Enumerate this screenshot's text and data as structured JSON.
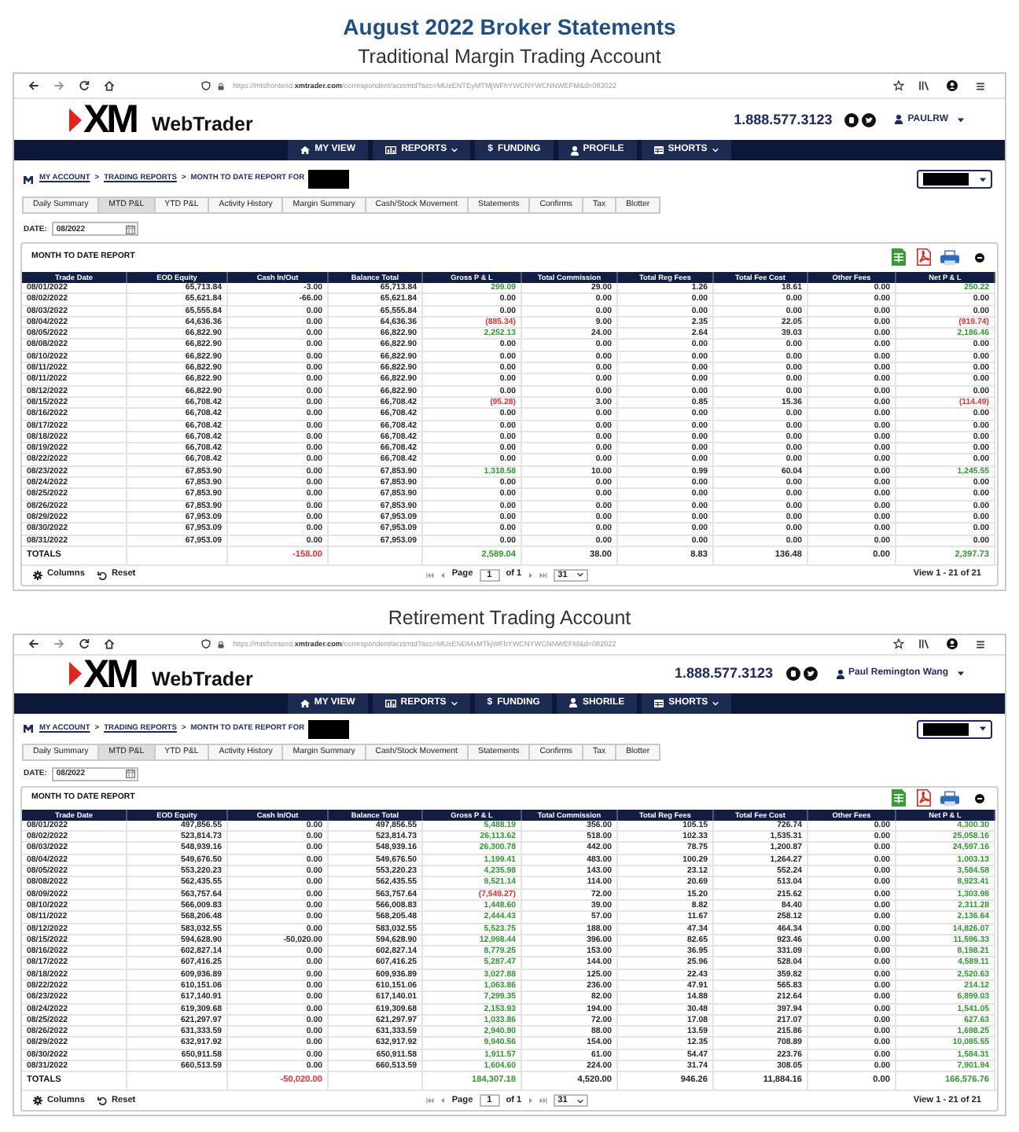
{
  "heading": {
    "title": "August 2022 Broker Statements"
  },
  "accounts": [
    {
      "subtitle": "Traditional Margin Trading Account",
      "browser": {
        "url": "https://mtsfrontend.**xmtrader.com**/correspondent/acctmtd?acc=MUxENTEyMTMjWFhYWCNYWCNNWEFM&d=082022"
      },
      "header": {
        "logo": "XM",
        "app_name": "WebTrader",
        "phone": "1.888.577.3123",
        "user": "PAULRW"
      },
      "nav": [
        {
          "label": "MY VIEW",
          "kind": "home",
          "dropdown": false
        },
        {
          "label": "REPORTS",
          "kind": "chart",
          "dropdown": true
        },
        {
          "label": "FUNDING",
          "kind": "symbol",
          "symbol": "$",
          "dropdown": false
        },
        {
          "label": "PROFILE",
          "kind": "person",
          "dropdown": false
        },
        {
          "label": "SHORTS",
          "kind": "table",
          "dropdown": true
        }
      ],
      "breadcrumb": [
        {
          "kind": "link",
          "text": "MY ACCOUNT"
        },
        {
          "kind": "separator",
          "text": ">"
        },
        {
          "kind": "link",
          "text": "TRADING REPORTS"
        },
        {
          "kind": "separator",
          "text": ">"
        },
        {
          "kind": "current",
          "text": "MONTH TO DATE REPORT FOR"
        }
      ],
      "tabs": [
        {
          "label": "Daily Summary",
          "selected": false
        },
        {
          "label": "MTD P&L",
          "selected": true
        },
        {
          "label": "YTD P&L",
          "selected": false
        },
        {
          "label": "Activity History",
          "selected": false
        },
        {
          "label": "Margin Summary",
          "selected": false
        },
        {
          "label": "Cash/Stock Movement",
          "selected": false
        },
        {
          "label": "Statements",
          "selected": false
        },
        {
          "label": "Confirms",
          "selected": false
        },
        {
          "label": "Tax",
          "selected": false
        },
        {
          "label": "Blotter",
          "selected": false
        }
      ],
      "date": {
        "label": "DATE:",
        "value": "08/2022"
      },
      "report": {
        "title": "MONTH TO DATE REPORT",
        "columns": [
          "Trade Date",
          "EOD Equity",
          "Cash In/Out",
          "Balance Total",
          "Gross P & L",
          "Total Commission",
          "Total Reg Fees",
          "Total Fee Cost",
          "Other Fees",
          "Net P & L"
        ],
        "rows": [
          {
            "cells": [
              "08/01/2022",
              "65,713.84",
              "-3.00",
              "65,713.84",
              {
                "text": "299.09",
                "color": "#2f9a2f"
              },
              "29.00",
              "1.26",
              "18.61",
              "0.00",
              {
                "text": "250.22",
                "color": "#2f9a2f"
              }
            ]
          },
          {
            "cells": [
              "08/02/2022",
              "65,621.84",
              "-66.00",
              "65,621.84",
              {
                "text": "0.00",
                "color": "#262626"
              },
              "0.00",
              "0.00",
              "0.00",
              "0.00",
              {
                "text": "0.00",
                "color": "#262626"
              }
            ]
          },
          {
            "cells": [
              "08/03/2022",
              "65,555.84",
              "0.00",
              "65,555.84",
              {
                "text": "0.00",
                "color": "#262626"
              },
              "0.00",
              "0.00",
              "0.00",
              "0.00",
              {
                "text": "0.00",
                "color": "#262626"
              }
            ]
          },
          {
            "cells": [
              "08/04/2022",
              "64,636.36",
              "0.00",
              "64,636.36",
              {
                "text": "(885.34)",
                "color": "#ee2f2f"
              },
              "9.00",
              "2.35",
              "22.05",
              "0.00",
              {
                "text": "(919.74)",
                "color": "#ee2f2f"
              }
            ]
          },
          {
            "cells": [
              "08/05/2022",
              "66,822.90",
              "0.00",
              "66,822.90",
              {
                "text": "2,252.13",
                "color": "#2f9a2f"
              },
              "24.00",
              "2.64",
              "39.03",
              "0.00",
              {
                "text": "2,186.46",
                "color": "#2f9a2f"
              }
            ]
          },
          {
            "cells": [
              "08/08/2022",
              "66,822.90",
              "0.00",
              "66,822.90",
              {
                "text": "0.00",
                "color": "#262626"
              },
              "0.00",
              "0.00",
              "0.00",
              "0.00",
              {
                "text": "0.00",
                "color": "#262626"
              }
            ]
          },
          {
            "cells": [
              "08/10/2022",
              "66,822.90",
              "0.00",
              "66,822.90",
              {
                "text": "0.00",
                "color": "#262626"
              },
              "0.00",
              "0.00",
              "0.00",
              "0.00",
              {
                "text": "0.00",
                "color": "#262626"
              }
            ]
          },
          {
            "cells": [
              "08/11/2022",
              "66,822.90",
              "0.00",
              "66,822.90",
              {
                "text": "0.00",
                "color": "#262626"
              },
              "0.00",
              "0.00",
              "0.00",
              "0.00",
              {
                "text": "0.00",
                "color": "#262626"
              }
            ]
          },
          {
            "cells": [
              "08/11/2022",
              "66,822.90",
              "0.00",
              "66,822.90",
              {
                "text": "0.00",
                "color": "#262626"
              },
              "0.00",
              "0.00",
              "0.00",
              "0.00",
              {
                "text": "0.00",
                "color": "#262626"
              }
            ]
          },
          {
            "cells": [
              "08/12/2022",
              "66,822.90",
              "0.00",
              "66,822.90",
              {
                "text": "0.00",
                "color": "#262626"
              },
              "0.00",
              "0.00",
              "0.00",
              "0.00",
              {
                "text": "0.00",
                "color": "#262626"
              }
            ]
          },
          {
            "cells": [
              "08/15/2022",
              "66,708.42",
              "0.00",
              "66,708.42",
              {
                "text": "(95.28)",
                "color": "#ee2f2f"
              },
              "3.00",
              "0.85",
              "15.36",
              "0.00",
              {
                "text": "(114.49)",
                "color": "#ee2f2f"
              }
            ]
          },
          {
            "cells": [
              "08/16/2022",
              "66,708.42",
              "0.00",
              "66,708.42",
              {
                "text": "0.00",
                "color": "#262626"
              },
              "0.00",
              "0.00",
              "0.00",
              "0.00",
              {
                "text": "0.00",
                "color": "#262626"
              }
            ]
          },
          {
            "cells": [
              "08/17/2022",
              "66,708.42",
              "0.00",
              "66,708.42",
              {
                "text": "0.00",
                "color": "#262626"
              },
              "0.00",
              "0.00",
              "0.00",
              "0.00",
              {
                "text": "0.00",
                "color": "#262626"
              }
            ]
          },
          {
            "cells": [
              "08/18/2022",
              "66,708.42",
              "0.00",
              "66,708.42",
              {
                "text": "0.00",
                "color": "#262626"
              },
              "0.00",
              "0.00",
              "0.00",
              "0.00",
              {
                "text": "0.00",
                "color": "#262626"
              }
            ]
          },
          {
            "cells": [
              "08/19/2022",
              "66,708.42",
              "0.00",
              "66,708.42",
              {
                "text": "0.00",
                "color": "#262626"
              },
              "0.00",
              "0.00",
              "0.00",
              "0.00",
              {
                "text": "0.00",
                "color": "#262626"
              }
            ]
          },
          {
            "cells": [
              "08/22/2022",
              "66,708.42",
              "0.00",
              "66,708.42",
              {
                "text": "0.00",
                "color": "#262626"
              },
              "0.00",
              "0.00",
              "0.00",
              "0.00",
              {
                "text": "0.00",
                "color": "#262626"
              }
            ]
          },
          {
            "cells": [
              "08/23/2022",
              "67,853.90",
              "0.00",
              "67,853.90",
              {
                "text": "1,318.58",
                "color": "#2f9a2f"
              },
              "10.00",
              "0.99",
              "60.04",
              "0.00",
              {
                "text": "1,245.55",
                "color": "#2f9a2f"
              }
            ]
          },
          {
            "cells": [
              "08/24/2022",
              "67,853.90",
              "0.00",
              "67,853.90",
              {
                "text": "0.00",
                "color": "#262626"
              },
              "0.00",
              "0.00",
              "0.00",
              "0.00",
              {
                "text": "0.00",
                "color": "#262626"
              }
            ]
          },
          {
            "cells": [
              "08/25/2022",
              "67,853.90",
              "0.00",
              "67,853.90",
              {
                "text": "0.00",
                "color": "#262626"
              },
              "0.00",
              "0.00",
              "0.00",
              "0.00",
              {
                "text": "0.00",
                "color": "#262626"
              }
            ]
          },
          {
            "cells": [
              "08/26/2022",
              "67,853.90",
              "0.00",
              "67,853.90",
              {
                "text": "0.00",
                "color": "#262626"
              },
              "0.00",
              "0.00",
              "0.00",
              "0.00",
              {
                "text": "0.00",
                "color": "#262626"
              }
            ]
          },
          {
            "cells": [
              "08/29/2022",
              "67,953.09",
              "0.00",
              "67,953.09",
              {
                "text": "0.00",
                "color": "#262626"
              },
              "0.00",
              "0.00",
              "0.00",
              "0.00",
              {
                "text": "0.00",
                "color": "#262626"
              }
            ]
          },
          {
            "cells": [
              "08/30/2022",
              "67,953.09",
              "0.00",
              "67,953.09",
              {
                "text": "0.00",
                "color": "#262626"
              },
              "0.00",
              "0.00",
              "0.00",
              "0.00",
              {
                "text": "0.00",
                "color": "#262626"
              }
            ]
          },
          {
            "cells": [
              "08/31/2022",
              "67,953.09",
              "0.00",
              "67,953.09",
              {
                "text": "0.00",
                "color": "#262626"
              },
              "0.00",
              "0.00",
              "0.00",
              "0.00",
              {
                "text": "0.00",
                "color": "#262626"
              }
            ]
          }
        ],
        "totals": {
          "label": "TOTALS",
          "cash_in_out": {
            "text": "-158.00",
            "color": "#ee2f2f"
          },
          "gross_pl": {
            "text": "2,589.04",
            "color": "#2f9a2f"
          },
          "total_commission": "38.00",
          "total_reg_fees": "8.83",
          "total_fee_cost": "136.48",
          "other_fees": "0.00",
          "net_pl": {
            "text": "2,397.73",
            "color": "#2f9a2f"
          }
        }
      },
      "footer": {
        "columns": "Columns",
        "reset": "Reset",
        "page_label": "Page",
        "page": "1",
        "page_total": "of 1",
        "page_size": "31",
        "record_count": "View 1 - 21 of 21"
      }
    },
    {
      "subtitle": "Retirement Trading Account",
      "browser": {
        "url": "https://mtsfrontend.**xmtrader.com**/correspondent/acctmtd?acc=MUxENDMxMTkjWFhYWCNYWCNNWEFM&d=082022"
      },
      "header": {
        "logo": "XM",
        "app_name": "WebTrader",
        "phone": "1.888.577.3123",
        "user": "Paul Remington Wang"
      },
      "nav": [
        {
          "label": "MY VIEW",
          "kind": "home",
          "dropdown": false
        },
        {
          "label": "REPORTS",
          "kind": "chart",
          "dropdown": true
        },
        {
          "label": "FUNDING",
          "kind": "symbol",
          "symbol": "$",
          "dropdown": false
        },
        {
          "label": "SHORILE",
          "kind": "person",
          "dropdown": false
        },
        {
          "label": "SHORTS",
          "kind": "table",
          "dropdown": true
        }
      ],
      "breadcrumb": [
        {
          "kind": "link",
          "text": "MY ACCOUNT"
        },
        {
          "kind": "separator",
          "text": ">"
        },
        {
          "kind": "link",
          "text": "TRADING REPORTS"
        },
        {
          "kind": "separator",
          "text": ">"
        },
        {
          "kind": "current",
          "text": "MONTH TO DATE REPORT FOR"
        }
      ],
      "tabs": [
        {
          "label": "Daily Summary",
          "selected": false
        },
        {
          "label": "MTD P&L",
          "selected": true
        },
        {
          "label": "YTD P&L",
          "selected": false
        },
        {
          "label": "Activity History",
          "selected": false
        },
        {
          "label": "Margin Summary",
          "selected": false
        },
        {
          "label": "Cash/Stock Movement",
          "selected": false
        },
        {
          "label": "Statements",
          "selected": false
        },
        {
          "label": "Confirms",
          "selected": false
        },
        {
          "label": "Tax",
          "selected": false
        },
        {
          "label": "Blotter",
          "selected": false
        }
      ],
      "date": {
        "label": "DATE:",
        "value": "08/2022"
      },
      "report": {
        "title": "MONTH TO DATE REPORT",
        "columns": [
          "Trade Date",
          "EOD Equity",
          "Cash In/Out",
          "Balance Total",
          "Gross P & L",
          "Total Commission",
          "Total Reg Fees",
          "Total Fee Cost",
          "Other Fees",
          "Net P & L"
        ],
        "rows": [
          {
            "cells": [
              "08/01/2022",
              "497,856.55",
              "0.00",
              "497,856.55",
              {
                "text": "5,488.19",
                "color": "#2f9a2f"
              },
              "356.00",
              "105.15",
              "726.74",
              "0.00",
              {
                "text": "4,300.30",
                "color": "#2f9a2f"
              }
            ]
          },
          {
            "cells": [
              "08/02/2022",
              "523,814.73",
              "0.00",
              "523,814.73",
              {
                "text": "26,113.62",
                "color": "#2f9a2f"
              },
              "518.00",
              "102.33",
              "1,535.31",
              "0.00",
              {
                "text": "25,058.16",
                "color": "#2f9a2f"
              }
            ]
          },
          {
            "cells": [
              "08/03/2022",
              "548,939.16",
              "0.00",
              "548,939.16",
              {
                "text": "26,300.78",
                "color": "#2f9a2f"
              },
              "442.00",
              "78.75",
              "1,200.87",
              "0.00",
              {
                "text": "24,597.16",
                "color": "#2f9a2f"
              }
            ]
          },
          {
            "cells": [
              "08/04/2022",
              "549,676.50",
              "0.00",
              "549,676.50",
              {
                "text": "1,199.41",
                "color": "#2f9a2f"
              },
              "483.00",
              "100.29",
              "1,264.27",
              "0.00",
              {
                "text": "1,003.13",
                "color": "#2f9a2f"
              }
            ]
          },
          {
            "cells": [
              "08/05/2022",
              "553,220.23",
              "0.00",
              "553,220.23",
              {
                "text": "4,235.98",
                "color": "#2f9a2f"
              },
              "143.00",
              "23.12",
              "552.24",
              "0.00",
              {
                "text": "3,584.58",
                "color": "#2f9a2f"
              }
            ]
          },
          {
            "cells": [
              "08/08/2022",
              "562,435.55",
              "0.00",
              "562,435.55",
              {
                "text": "9,521.14",
                "color": "#2f9a2f"
              },
              "114.00",
              "20.69",
              "513.04",
              "0.00",
              {
                "text": "8,923.41",
                "color": "#2f9a2f"
              }
            ]
          },
          {
            "cells": [
              "08/09/2022",
              "563,757.64",
              "0.00",
              "563,757.64",
              {
                "text": "(7,549.27)",
                "color": "#ee2f2f"
              },
              "72.00",
              "15.20",
              "215.62",
              "0.00",
              {
                "text": "1,303.98",
                "color": "#2f9a2f"
              }
            ]
          },
          {
            "cells": [
              "08/10/2022",
              "566,009.83",
              "0.00",
              "566,008.83",
              {
                "text": "1,448.60",
                "color": "#2f9a2f"
              },
              "39.00",
              "8.82",
              "84.40",
              "0.00",
              {
                "text": "2,311.28",
                "color": "#2f9a2f"
              }
            ]
          },
          {
            "cells": [
              "08/11/2022",
              "568,206.48",
              "0.00",
              "568,205.48",
              {
                "text": "2,444.43",
                "color": "#2f9a2f"
              },
              "57.00",
              "11.67",
              "258.12",
              "0.00",
              {
                "text": "2,136.64",
                "color": "#2f9a2f"
              }
            ]
          },
          {
            "cells": [
              "08/12/2022",
              "583,032.55",
              "0.00",
              "583,032.55",
              {
                "text": "5,523.75",
                "color": "#2f9a2f"
              },
              "188.00",
              "47.34",
              "464.34",
              "0.00",
              {
                "text": "14,826.07",
                "color": "#2f9a2f"
              }
            ]
          },
          {
            "cells": [
              "08/15/2022",
              "594,628.90",
              "-50,020.00",
              "594,628.90",
              {
                "text": "12,998.44",
                "color": "#2f9a2f"
              },
              "396.00",
              "82.65",
              "923.46",
              "0.00",
              {
                "text": "11,596.33",
                "color": "#2f9a2f"
              }
            ]
          },
          {
            "cells": [
              "08/16/2022",
              "602,827.14",
              "0.00",
              "602,827.14",
              {
                "text": "8,779.25",
                "color": "#2f9a2f"
              },
              "153.00",
              "36.95",
              "331.09",
              "0.00",
              {
                "text": "8,198.21",
                "color": "#2f9a2f"
              }
            ]
          },
          {
            "cells": [
              "08/17/2022",
              "607,416.25",
              "0.00",
              "607,416.25",
              {
                "text": "5,287.47",
                "color": "#2f9a2f"
              },
              "144.00",
              "25.96",
              "528.04",
              "0.00",
              {
                "text": "4,589.11",
                "color": "#2f9a2f"
              }
            ]
          },
          {
            "cells": [
              "08/18/2022",
              "609,936.89",
              "0.00",
              "609,936.89",
              {
                "text": "3,027.88",
                "color": "#2f9a2f"
              },
              "125.00",
              "22.43",
              "359.82",
              "0.00",
              {
                "text": "2,520.63",
                "color": "#2f9a2f"
              }
            ]
          },
          {
            "cells": [
              "08/22/2022",
              "610,151.06",
              "0.00",
              "610,151.06",
              {
                "text": "1,063.86",
                "color": "#2f9a2f"
              },
              "236.00",
              "47.91",
              "565.83",
              "0.00",
              {
                "text": "214.12",
                "color": "#2f9a2f"
              }
            ]
          },
          {
            "cells": [
              "08/23/2022",
              "617,140.91",
              "0.00",
              "617,140.01",
              {
                "text": "7,299.35",
                "color": "#2f9a2f"
              },
              "82.00",
              "14.88",
              "212.64",
              "0.00",
              {
                "text": "6,899.03",
                "color": "#2f9a2f"
              }
            ]
          },
          {
            "cells": [
              "08/24/2022",
              "619,309.68",
              "0.00",
              "619,309.68",
              {
                "text": "2,153.93",
                "color": "#2f9a2f"
              },
              "194.00",
              "30.48",
              "397.94",
              "0.00",
              {
                "text": "1,541.05",
                "color": "#2f9a2f"
              }
            ]
          },
          {
            "cells": [
              "08/25/2022",
              "621,297.97",
              "0.00",
              "621,297.97",
              {
                "text": "1,033.86",
                "color": "#2f9a2f"
              },
              "72.00",
              "17.08",
              "217.07",
              "0.00",
              {
                "text": "627.63",
                "color": "#2f9a2f"
              }
            ]
          },
          {
            "cells": [
              "08/26/2022",
              "631,333.59",
              "0.00",
              "631,333.59",
              {
                "text": "2,940.90",
                "color": "#2f9a2f"
              },
              "88.00",
              "13.59",
              "215.86",
              "0.00",
              {
                "text": "1,698.25",
                "color": "#2f9a2f"
              }
            ]
          },
          {
            "cells": [
              "08/29/2022",
              "632,917.92",
              "0.00",
              "632,917.92",
              {
                "text": "9,940.56",
                "color": "#2f9a2f"
              },
              "154.00",
              "12.35",
              "708.89",
              "0.00",
              {
                "text": "10,085.55",
                "color": "#2f9a2f"
              }
            ]
          },
          {
            "cells": [
              "08/30/2022",
              "650,911.58",
              "0.00",
              "650,911.58",
              {
                "text": "1,911.57",
                "color": "#2f9a2f"
              },
              "61.00",
              "54.47",
              "223.76",
              "0.00",
              {
                "text": "1,584.31",
                "color": "#2f9a2f"
              }
            ]
          },
          {
            "cells": [
              "08/31/2022",
              "660,513.59",
              "0.00",
              "660,513.59",
              {
                "text": "1,604.60",
                "color": "#2f9a2f"
              },
              "224.00",
              "31.74",
              "308.05",
              "0.00",
              {
                "text": "7,901.94",
                "color": "#2f9a2f"
              }
            ]
          }
        ],
        "totals": {
          "label": "TOTALS",
          "cash_in_out": {
            "text": "-50,020.00",
            "color": "#ee2f2f"
          },
          "gross_pl": {
            "text": "184,307.18",
            "color": "#2f9a2f"
          },
          "total_commission": "4,520.00",
          "total_reg_fees": "946.26",
          "total_fee_cost": "11,884.16",
          "other_fees": "0.00",
          "net_pl": {
            "text": "166,576.76",
            "color": "#2f9a2f"
          }
        }
      },
      "footer": {
        "columns": "Columns",
        "reset": "Reset",
        "page_label": "Page",
        "page": "1",
        "page_total": "of 1",
        "page_size": "31",
        "record_count": "View 1 - 21 of 21"
      }
    }
  ]
}
